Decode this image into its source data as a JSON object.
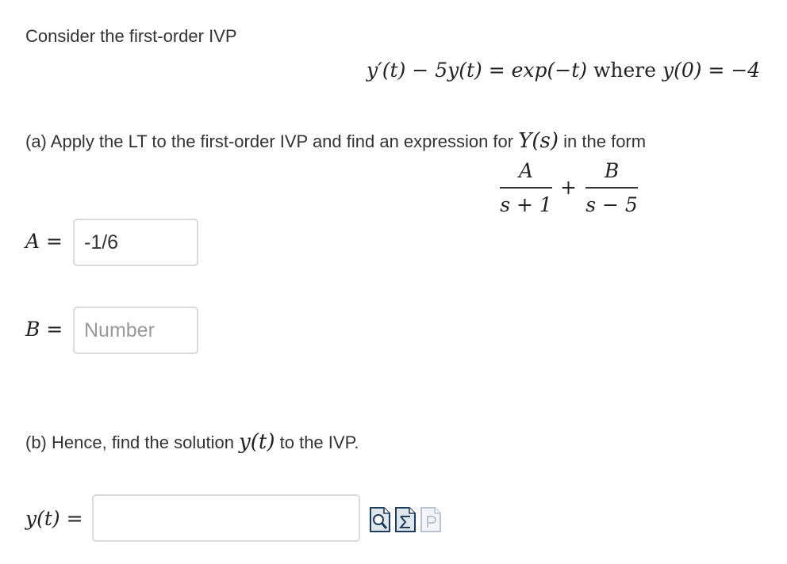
{
  "intro": "Consider the first-order IVP",
  "equation": {
    "lhs": "y′(t) − 5y(t) = exp(−t)",
    "where": "where",
    "ic": "y(0) = −4"
  },
  "part_a": {
    "prefix": "(a) Apply the LT to the first-order IVP and find an expression for",
    "symbol": "Y(s)",
    "suffix": "in the form",
    "form": {
      "num1": "A",
      "den1": "s + 1",
      "plus": "+",
      "num2": "B",
      "den2": "s − 5"
    },
    "A_label": "A =",
    "A_value": "-1/6",
    "B_label": "B =",
    "B_value": "",
    "B_placeholder": "Number"
  },
  "part_b": {
    "prefix": "(b) Hence, find the solution",
    "symbol": "y(t)",
    "suffix": "to the IVP.",
    "y_label": "y(t) =",
    "y_value": "",
    "tools": [
      "preview-icon",
      "equation-editor-icon",
      "parse-icon"
    ]
  }
}
